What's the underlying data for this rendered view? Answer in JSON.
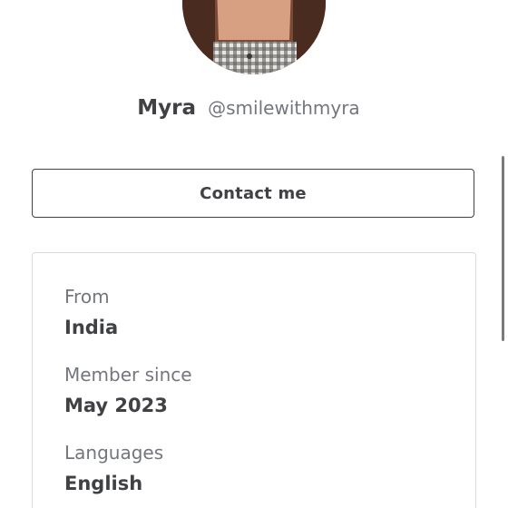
{
  "profile": {
    "display_name": "Myra",
    "username": "@smilewithmyra"
  },
  "contact_button": {
    "label": "Contact me"
  },
  "info": {
    "items": [
      {
        "label": "From",
        "value": "India"
      },
      {
        "label": "Member since",
        "value": "May 2023"
      },
      {
        "label": "Languages",
        "value": "English"
      }
    ]
  },
  "colors": {
    "text_primary": "#404145",
    "text_secondary": "#74767e",
    "card_border": "#dadbdd",
    "button_border": "#404145"
  },
  "icons": {
    "avatar": "profile-photo"
  }
}
